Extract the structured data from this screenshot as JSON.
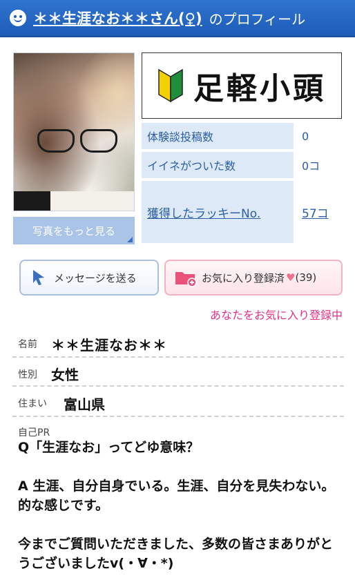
{
  "header": {
    "name": "＊＊生涯なお＊＊さん(♀)",
    "suffix": "のプロフィール",
    "icon": "smiley-icon"
  },
  "photo": {
    "more_label": "写真をもっと見る"
  },
  "badge": {
    "text": "足軽小頭",
    "icon": "beginner-mark-icon",
    "colors": {
      "green": "#1e8e3a",
      "yellow": "#f5d000"
    }
  },
  "stats": [
    {
      "label": "体験談投稿数",
      "value": "0"
    },
    {
      "label": "イイネがついた数",
      "value": "0コ"
    },
    {
      "label": "獲得したラッキーNo.",
      "value": "57コ"
    }
  ],
  "actions": {
    "message_label": "メッセージを送る",
    "favorite_label": "お気に入り登録済",
    "favorite_heart": "♥",
    "favorite_count": "(39)",
    "favorite_status": "あなたをお気に入り登録中"
  },
  "profile": {
    "name_label": "名前",
    "name_value": "＊＊生涯なお＊＊",
    "gender_label": "性別",
    "gender_value": "女性",
    "home_label": "住まい",
    "home_value": "富山県",
    "pr_label": "自己PR",
    "pr_text": "Q「生涯なお」ってどゆ意味？\n\nA 生涯、自分自身でいる。生涯、自分を見失わない。的な感じです。\n\n今までご質問いただきました、多数の皆さまありがとうございましたv(・∀・*)"
  },
  "colors": {
    "header_blue": "#1d5cb8",
    "link_blue": "#2a5ea8",
    "pink": "#e2318a"
  }
}
